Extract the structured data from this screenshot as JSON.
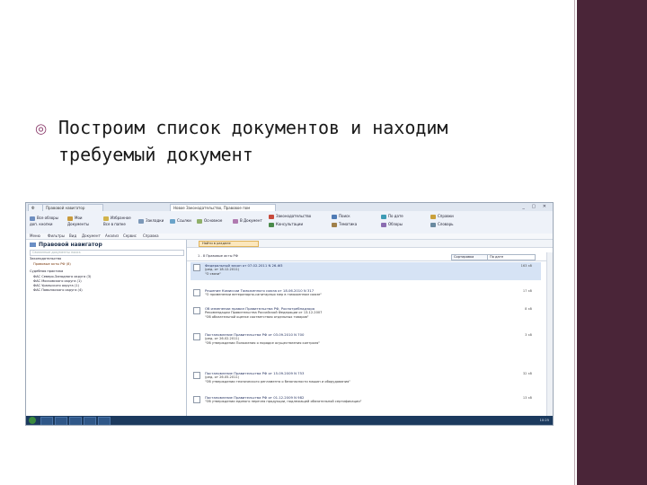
{
  "slide": {
    "bullet_text_line1": "Построим список документов и находим",
    "bullet_text_line2": "требуемый документ",
    "accent_color": "#4a2538"
  },
  "window": {
    "tabs": [
      "Ф",
      "Правовой навигатор",
      "Новое Законодательство, Правовое пом"
    ],
    "controls": "_ ▢ ✕"
  },
  "ribbon": {
    "groups": [
      {
        "l1": "Все обзоры",
        "l2": "доп. кнопки"
      },
      {
        "l1": "Мои",
        "l2": "Документы"
      },
      {
        "l1": "Избранное",
        "l2": "Все в папке"
      },
      {
        "l1": "Закладки",
        "l2": ""
      },
      {
        "l1": "Ссылки",
        "l2": ""
      },
      {
        "l1": "Основное",
        "l2": ""
      },
      {
        "l1": "В Документ",
        "l2": ""
      }
    ],
    "right_items": [
      "Законодательство",
      "Консультации",
      "Поиск",
      "Тематика",
      "По дате",
      "Обзоры",
      "Справки",
      "Словарь"
    ]
  },
  "menubar": [
    "Меню",
    "Фильтры",
    "Вид",
    "Документ",
    "Анализ",
    "Сервис",
    "Справка"
  ],
  "left": {
    "title": "Правовой навигатор",
    "search_placeholder": "Связанные документы поиск",
    "tree": [
      "Законодательство",
      "Правовые акты РФ (8)",
      "Судебная практика",
      "ФАС Северо-Западного округа (3)",
      "ФАС Московского округа (1)",
      "ФАС Уральского округа (1)",
      "ФАС Поволжского округа (4)"
    ]
  },
  "right": {
    "toolbar_button": "Найти в разделе",
    "list_header": "1 - 8 Правовые акты РФ",
    "sort_label": "Сортировка",
    "select_label": "По дате",
    "docs": [
      {
        "title": "Федеральный закон от 07.02.2011 N 26-ФЗ",
        "l2": "(ред. от 18.12.2011)",
        "l3": "\"О связи\"",
        "size": "163 кб"
      },
      {
        "title": "Решение Комиссии Таможенного союза от 18.06.2010 N 317",
        "l2": "\"О применении ветеринарно-санитарных мер в таможенном союзе\"",
        "l3": "",
        "size": "17 кб"
      },
      {
        "title": "Об изменении правил Правительства РФ, Роспотребнадзора",
        "l2": "Рекомендации Правительства Российской Федерации от 13.12.2007",
        "l3": "\"Об обязательной оценке соответствия отдельных товаров\"",
        "size": "8 кб"
      },
      {
        "title": "Постановление Правительства РФ от 03.09.2010 N 700",
        "l2": "(ред. от 26.02.2011)",
        "l3": "\"Об утверждении Положения о порядке осуществления контроля\"",
        "size": "3 кб"
      },
      {
        "title": "Постановление Правительства РФ от 15.09.2009 N 753",
        "l2": "(ред. от 26.05.2011)",
        "l3": "\"Об утверждении технического регламента о безопасности машин и оборудования\"",
        "size": "32 кб"
      },
      {
        "title": "Постановление Правительства РФ от 01.12.2009 N 982",
        "l2": "\"Об утверждении единого перечня продукции, подлежащей обязательной сертификации\"",
        "l3": "",
        "size": "13 кб"
      }
    ]
  },
  "taskbar": {
    "clock": "10:25"
  }
}
